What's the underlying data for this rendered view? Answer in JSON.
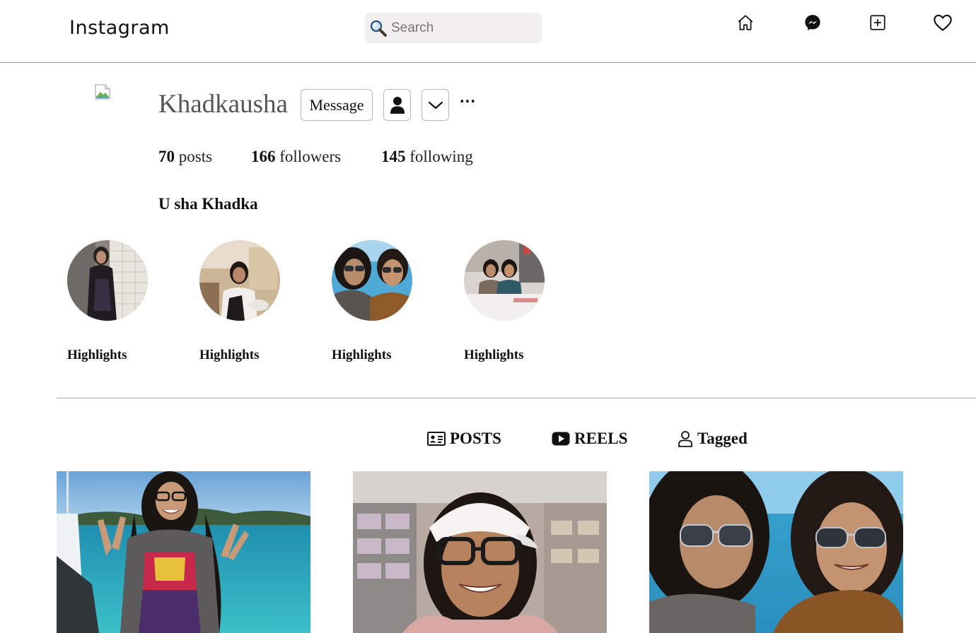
{
  "header": {
    "logo": "Instagram",
    "search_placeholder": "Search",
    "icons": [
      "home-icon",
      "messenger-icon",
      "new-post-icon",
      "heart-icon"
    ]
  },
  "profile": {
    "username": "Khadkausha",
    "message_label": "Message",
    "more_label": "...",
    "stats": [
      {
        "count": "70",
        "label": "posts"
      },
      {
        "count": "166",
        "label": "followers"
      },
      {
        "count": "145",
        "label": "following"
      }
    ],
    "full_name": "U sha Khadka"
  },
  "highlights": [
    {
      "label": "Highlights"
    },
    {
      "label": "Highlights"
    },
    {
      "label": "Highlights"
    },
    {
      "label": "Highlights"
    }
  ],
  "tabs": [
    {
      "label": "POSTS",
      "icon": "contact-card-icon"
    },
    {
      "label": "REELS",
      "icon": "play-icon"
    },
    {
      "label": "Tagged",
      "icon": "person-outline-icon"
    }
  ],
  "colors": {
    "search_bg": "#f1efef",
    "divider": "#a8a8a8",
    "username": "#555555",
    "text": "#111111"
  }
}
